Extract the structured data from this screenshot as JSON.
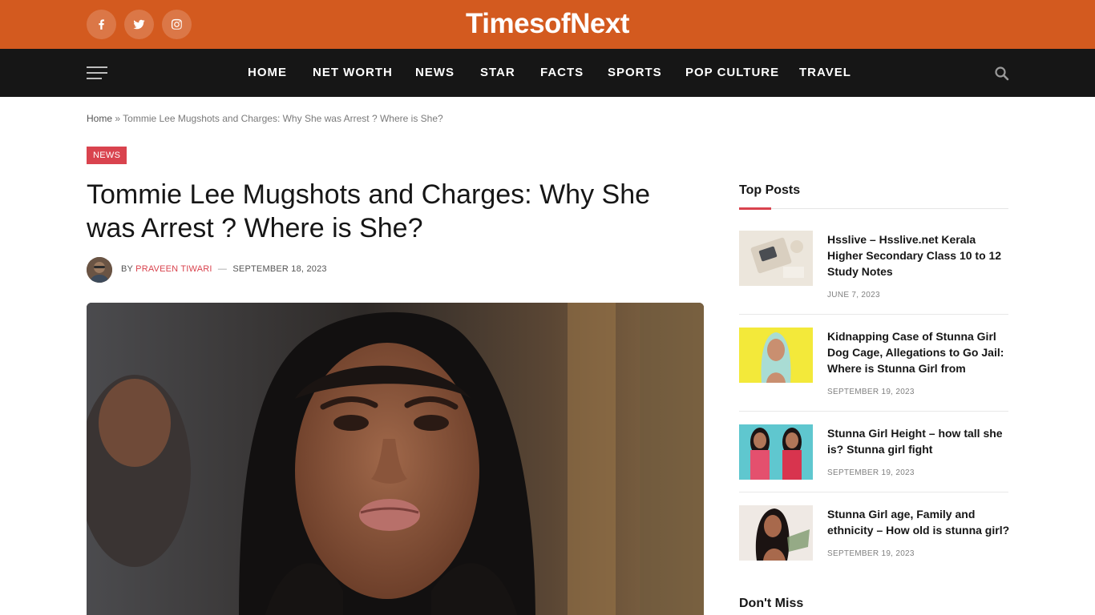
{
  "site": {
    "logo": "TimesofNext",
    "social": [
      "facebook-icon",
      "twitter-icon",
      "instagram-icon"
    ],
    "colors": {
      "topbar": "#d35a1f",
      "navbar": "#161616",
      "accent": "#d9434e"
    }
  },
  "nav": {
    "items": [
      "HOME",
      "NET WORTH",
      "NEWS",
      "STAR",
      "FACTS",
      "SPORTS",
      "POP CULTURE",
      "TRAVEL"
    ]
  },
  "breadcrumb": {
    "home": "Home",
    "separator": "»",
    "current": "Tommie Lee Mugshots and Charges: Why She was Arrest ? Where is She?"
  },
  "article": {
    "category": "NEWS",
    "title": "Tommie Lee Mugshots and Charges: Why She was Arrest ? Where is She?",
    "by": "BY",
    "author": "PRAVEEN TIWARI",
    "dash": "—",
    "date": "SEPTEMBER 18, 2023"
  },
  "sidebar": {
    "title": "Top Posts",
    "posts": [
      {
        "title": "Hsslive – Hsslive.net Kerala Higher Secondary Class 10 to 12 Study Notes",
        "date": "JUNE 7, 2023"
      },
      {
        "title": "Kidnapping Case of Stunna Girl Dog Cage, Allegations to Go Jail: Where is Stunna Girl from",
        "date": "SEPTEMBER 19, 2023"
      },
      {
        "title": "Stunna Girl Height – how tall she is? Stunna girl fight",
        "date": "SEPTEMBER 19, 2023"
      },
      {
        "title": "Stunna Girl age, Family and ethnicity – How old is stunna girl?",
        "date": "SEPTEMBER 19, 2023"
      }
    ],
    "next_section": "Don't Miss"
  }
}
